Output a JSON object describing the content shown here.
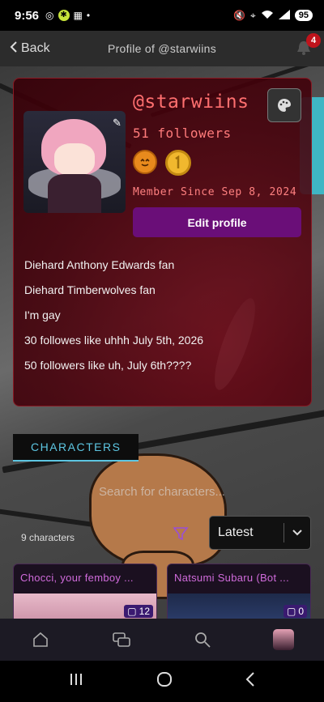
{
  "status_bar": {
    "time": "9:56",
    "battery": "95",
    "signal": "6"
  },
  "header": {
    "back_label": "Back",
    "title": "Profile of @starwiins",
    "notification_count": "4"
  },
  "profile": {
    "username": "@starwiins",
    "followers": "51 followers",
    "member_since": "Member Since Sep 8, 2024",
    "edit_button": "Edit profile",
    "badges": [
      "pumpkin-badge-icon",
      "gold-coin-badge-icon"
    ],
    "bio": [
      "Diehard Anthony Edwards fan",
      "Diehard Timberwolves fan",
      "I'm gay",
      "30 followes like uhhh July 5th, 2026",
      "50 followers like uh, July 6th????"
    ]
  },
  "characters": {
    "tab_label": "CHARACTERS",
    "search_placeholder": "Search for characters...",
    "count": "9 characters",
    "sort_selected": "Latest",
    "items": [
      {
        "name": "Chocci, your femboy ...",
        "chats": "12"
      },
      {
        "name": "Natsumi Subaru (Bot ...",
        "chats": "0"
      }
    ]
  },
  "bottom_nav": [
    "home-icon",
    "chats-icon",
    "search-icon",
    "profile-avatar"
  ],
  "colors": {
    "accent_red": "#ff6f6f",
    "edit_button": "#6a0e78",
    "tab_accent": "#5dc6e2",
    "character_name": "#d06bdb"
  }
}
